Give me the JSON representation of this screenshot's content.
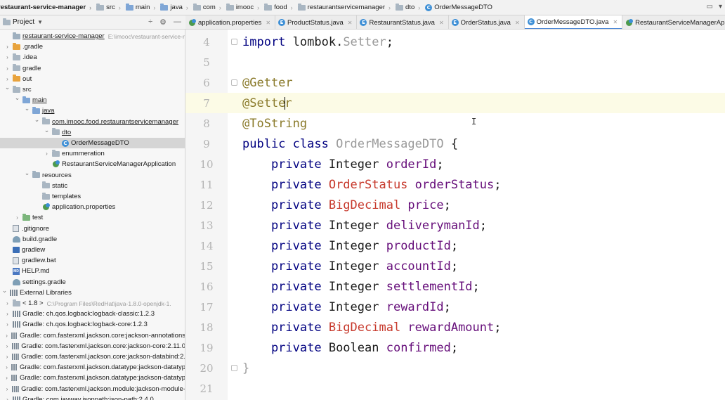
{
  "breadcrumb": [
    {
      "label": "restaurant-service-manager",
      "icon": "none"
    },
    {
      "label": "src",
      "icon": "folder"
    },
    {
      "label": "main",
      "icon": "folder-blue"
    },
    {
      "label": "java",
      "icon": "folder-blue"
    },
    {
      "label": "com",
      "icon": "folder"
    },
    {
      "label": "imooc",
      "icon": "folder"
    },
    {
      "label": "food",
      "icon": "folder"
    },
    {
      "label": "restaurantservicemanager",
      "icon": "folder"
    },
    {
      "label": "dto",
      "icon": "folder"
    },
    {
      "label": "OrderMessageDTO",
      "icon": "class"
    }
  ],
  "project": {
    "title": "Project",
    "tree": [
      {
        "label": "restaurant-service-manager",
        "path": "E:\\imooc\\restaurant-service-r",
        "depth": 0,
        "arrow": "none",
        "icon": "folder-res",
        "underline": true
      },
      {
        "label": ".gradle",
        "depth": 0,
        "arrow": "right",
        "icon": "folder-orange"
      },
      {
        "label": ".idea",
        "depth": 0,
        "arrow": "right",
        "icon": "folder"
      },
      {
        "label": "gradle",
        "depth": 0,
        "arrow": "right",
        "icon": "folder"
      },
      {
        "label": "out",
        "depth": 0,
        "arrow": "right",
        "icon": "folder-orange"
      },
      {
        "label": "src",
        "depth": 0,
        "arrow": "down",
        "icon": "folder"
      },
      {
        "label": "main",
        "depth": 1,
        "arrow": "down",
        "icon": "folder-blue",
        "underline": true
      },
      {
        "label": "java",
        "depth": 2,
        "arrow": "down",
        "icon": "folder-blue",
        "underline": true
      },
      {
        "label": "com.imooc.food.restaurantservicemanager",
        "depth": 3,
        "arrow": "down",
        "icon": "folder",
        "underline": true
      },
      {
        "label": "dto",
        "depth": 4,
        "arrow": "down",
        "icon": "folder",
        "underline": true
      },
      {
        "label": "OrderMessageDTO",
        "depth": 5,
        "arrow": "none",
        "icon": "class",
        "selected": true
      },
      {
        "label": "enummeration",
        "depth": 4,
        "arrow": "right",
        "icon": "folder"
      },
      {
        "label": "RestaurantServiceManagerApplication",
        "depth": 4,
        "arrow": "none",
        "icon": "spring"
      },
      {
        "label": "resources",
        "depth": 2,
        "arrow": "down",
        "icon": "folder-res"
      },
      {
        "label": "static",
        "depth": 3,
        "arrow": "none",
        "icon": "folder"
      },
      {
        "label": "templates",
        "depth": 3,
        "arrow": "none",
        "icon": "folder"
      },
      {
        "label": "application.properties",
        "depth": 3,
        "arrow": "none",
        "icon": "spring"
      },
      {
        "label": "test",
        "depth": 1,
        "arrow": "right",
        "icon": "folder-green"
      },
      {
        "label": ".gitignore",
        "depth": 0,
        "arrow": "none",
        "icon": "file"
      },
      {
        "label": "build.gradle",
        "depth": 0,
        "arrow": "none",
        "icon": "gradle"
      },
      {
        "label": "gradlew",
        "depth": 0,
        "arrow": "none",
        "icon": "term"
      },
      {
        "label": "gradlew.bat",
        "depth": 0,
        "arrow": "none",
        "icon": "file"
      },
      {
        "label": "HELP.md",
        "depth": 0,
        "arrow": "none",
        "icon": "md"
      },
      {
        "label": "settings.gradle",
        "depth": 0,
        "arrow": "none",
        "icon": "gradle"
      },
      {
        "label": "External Libraries",
        "depth": -1,
        "arrow": "down",
        "icon": "lib"
      },
      {
        "label": "< 1.8 >",
        "path": "C:\\Program Files\\RedHat\\java-1.8.0-openjdk-1.",
        "depth": 0,
        "arrow": "right",
        "icon": "folder"
      },
      {
        "label": "Gradle: ch.qos.logback:logback-classic:1.2.3",
        "depth": 0,
        "arrow": "right",
        "icon": "lib"
      },
      {
        "label": "Gradle: ch.qos.logback:logback-core:1.2.3",
        "depth": 0,
        "arrow": "right",
        "icon": "lib"
      },
      {
        "label": "Gradle: com.fasterxml.jackson.core:jackson-annotations",
        "depth": 0,
        "arrow": "right",
        "icon": "lib"
      },
      {
        "label": "Gradle: com.fasterxml.jackson.core:jackson-core:2.11.0",
        "depth": 0,
        "arrow": "right",
        "icon": "lib"
      },
      {
        "label": "Gradle: com.fasterxml.jackson.core:jackson-databind:2.",
        "depth": 0,
        "arrow": "right",
        "icon": "lib"
      },
      {
        "label": "Gradle: com.fasterxml.jackson.datatype:jackson-datatyp",
        "depth": 0,
        "arrow": "right",
        "icon": "lib"
      },
      {
        "label": "Gradle: com.fasterxml.jackson.datatype:jackson-datatyp",
        "depth": 0,
        "arrow": "right",
        "icon": "lib"
      },
      {
        "label": "Gradle: com.fasterxml.jackson.module:jackson-module-",
        "depth": 0,
        "arrow": "right",
        "icon": "lib"
      },
      {
        "label": "Gradle: com.jayway.jsonpath:json-path:2.4.0",
        "depth": 0,
        "arrow": "right",
        "icon": "lib"
      }
    ]
  },
  "tabs": [
    {
      "label": "application.properties",
      "icon": "spring",
      "active": false
    },
    {
      "label": "ProductStatus.java",
      "icon": "enum",
      "active": false
    },
    {
      "label": "RestaurantStatus.java",
      "icon": "enum",
      "active": false
    },
    {
      "label": "OrderStatus.java",
      "icon": "enum",
      "active": false
    },
    {
      "label": "OrderMessageDTO.java",
      "icon": "class",
      "active": true
    },
    {
      "label": "RestaurantServiceManagerApplica",
      "icon": "spring",
      "active": false
    }
  ],
  "editor": {
    "lines": [
      {
        "num": "4",
        "tokens": [
          {
            "t": "import ",
            "c": "kw"
          },
          {
            "t": "lombok.",
            "c": "ty"
          },
          {
            "t": "Setter",
            "c": "cls"
          },
          {
            "t": ";",
            "c": "ty"
          }
        ]
      },
      {
        "num": "5",
        "tokens": []
      },
      {
        "num": "6",
        "tokens": [
          {
            "t": "@Getter",
            "c": "ann"
          }
        ]
      },
      {
        "num": "7",
        "current": true,
        "tokens": [
          {
            "t": "@Sette",
            "c": "ann"
          },
          {
            "t": "|",
            "c": "caret"
          },
          {
            "t": "r",
            "c": "ann"
          }
        ]
      },
      {
        "num": "8",
        "tokens": [
          {
            "t": "@ToString",
            "c": "ann"
          }
        ]
      },
      {
        "num": "9",
        "tokens": [
          {
            "t": "public class ",
            "c": "kw"
          },
          {
            "t": "OrderMessageDTO",
            "c": "cls"
          },
          {
            "t": " {",
            "c": "ty"
          }
        ]
      },
      {
        "num": "10",
        "tokens": [
          {
            "t": "    private ",
            "c": "kw"
          },
          {
            "t": "Integer ",
            "c": "ty"
          },
          {
            "t": "orderId",
            "c": "fld"
          },
          {
            "t": ";",
            "c": "ty"
          }
        ]
      },
      {
        "num": "11",
        "tokens": [
          {
            "t": "    private ",
            "c": "kw"
          },
          {
            "t": "OrderStatus ",
            "c": "ty-red"
          },
          {
            "t": "orderStatus",
            "c": "fld"
          },
          {
            "t": ";",
            "c": "ty"
          }
        ]
      },
      {
        "num": "12",
        "tokens": [
          {
            "t": "    private ",
            "c": "kw"
          },
          {
            "t": "BigDecimal ",
            "c": "ty-red"
          },
          {
            "t": "price",
            "c": "fld"
          },
          {
            "t": ";",
            "c": "ty"
          }
        ]
      },
      {
        "num": "13",
        "tokens": [
          {
            "t": "    private ",
            "c": "kw"
          },
          {
            "t": "Integer ",
            "c": "ty"
          },
          {
            "t": "deliverymanId",
            "c": "fld"
          },
          {
            "t": ";",
            "c": "ty"
          }
        ]
      },
      {
        "num": "14",
        "tokens": [
          {
            "t": "    private ",
            "c": "kw"
          },
          {
            "t": "Integer ",
            "c": "ty"
          },
          {
            "t": "productId",
            "c": "fld"
          },
          {
            "t": ";",
            "c": "ty"
          }
        ]
      },
      {
        "num": "15",
        "tokens": [
          {
            "t": "    private ",
            "c": "kw"
          },
          {
            "t": "Integer ",
            "c": "ty"
          },
          {
            "t": "accountId",
            "c": "fld"
          },
          {
            "t": ";",
            "c": "ty"
          }
        ]
      },
      {
        "num": "16",
        "tokens": [
          {
            "t": "    private ",
            "c": "kw"
          },
          {
            "t": "Integer ",
            "c": "ty"
          },
          {
            "t": "settlementId",
            "c": "fld"
          },
          {
            "t": ";",
            "c": "ty"
          }
        ]
      },
      {
        "num": "17",
        "tokens": [
          {
            "t": "    private ",
            "c": "kw"
          },
          {
            "t": "Integer ",
            "c": "ty"
          },
          {
            "t": "rewardId",
            "c": "fld"
          },
          {
            "t": ";",
            "c": "ty"
          }
        ]
      },
      {
        "num": "18",
        "tokens": [
          {
            "t": "    private ",
            "c": "kw"
          },
          {
            "t": "BigDecimal ",
            "c": "ty-red"
          },
          {
            "t": "rewardAmount",
            "c": "fld"
          },
          {
            "t": ";",
            "c": "ty"
          }
        ]
      },
      {
        "num": "19",
        "tokens": [
          {
            "t": "    private ",
            "c": "kw"
          },
          {
            "t": "Boolean ",
            "c": "ty"
          },
          {
            "t": "confirmed",
            "c": "fld"
          },
          {
            "t": ";",
            "c": "ty"
          }
        ]
      },
      {
        "num": "20",
        "tokens": [
          {
            "t": "}",
            "c": "dim"
          }
        ]
      },
      {
        "num": "21",
        "tokens": []
      }
    ]
  },
  "colors": {
    "keyword": "#000080",
    "annotation": "#8a7a2a",
    "field": "#660e7a",
    "error_type": "#c7392c",
    "accent": "#4a87d6"
  }
}
